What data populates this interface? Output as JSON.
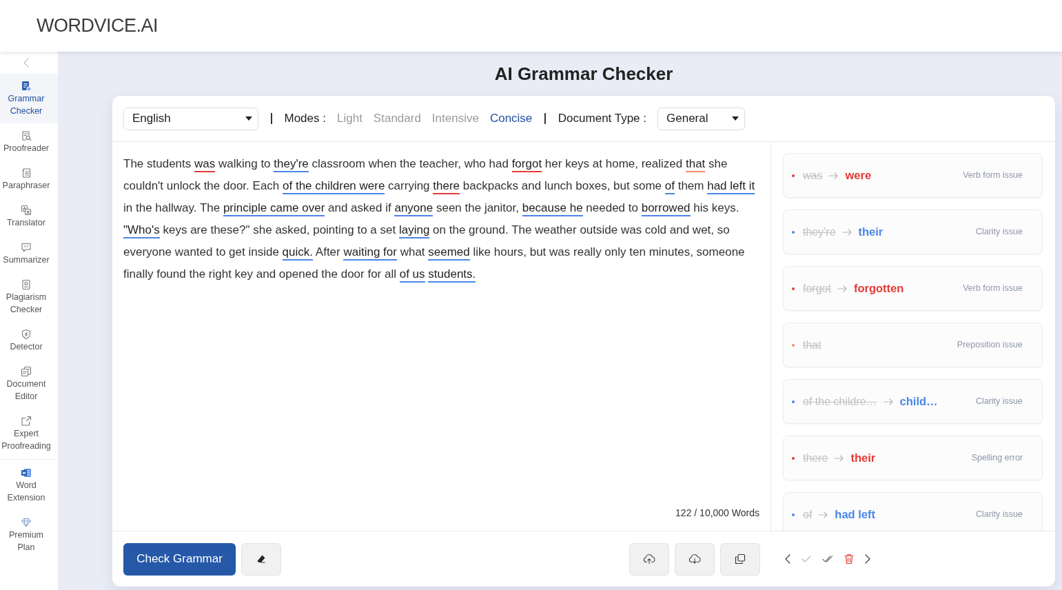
{
  "header": {
    "logo": "WORDVICE.AI"
  },
  "sidebar": {
    "items": [
      {
        "label": "Grammar Checker",
        "selected": true
      },
      {
        "label": "Proofreader",
        "selected": false
      },
      {
        "label": "Paraphraser",
        "selected": false
      },
      {
        "label": "Translator",
        "selected": false
      },
      {
        "label": "Summarizer",
        "selected": false
      },
      {
        "label": "Plagiarism Checker",
        "selected": false
      },
      {
        "label": "Detector",
        "selected": false
      },
      {
        "label": "Document Editor",
        "selected": false
      },
      {
        "label": "Expert Proofreading",
        "selected": false
      }
    ],
    "bottom_items": [
      {
        "label": "Word Extension",
        "selected": false
      },
      {
        "label": "Premium Plan",
        "selected": false
      }
    ]
  },
  "page_title": "AI Grammar Checker",
  "toolbar": {
    "language": "English",
    "modes_label": "Modes :",
    "modes": [
      {
        "label": "Light",
        "selected": false
      },
      {
        "label": "Standard",
        "selected": false
      },
      {
        "label": "Intensive",
        "selected": false
      },
      {
        "label": "Concise",
        "selected": true
      }
    ],
    "document_type_label": "Document Type :",
    "document_type": "General"
  },
  "editor": {
    "segments": [
      {
        "text": "The students "
      },
      {
        "text": "was",
        "color": "#e53935"
      },
      {
        "text": " walking to "
      },
      {
        "text": "they're",
        "color": "#4a86e8"
      },
      {
        "text": " classroom when the teacher, who had "
      },
      {
        "text": "forgot",
        "color": "#e53935"
      },
      {
        "text": " her keys at home, realized "
      },
      {
        "text": "that",
        "color": "#f28b6b"
      },
      {
        "text": " she couldn't unlock the door. Each "
      },
      {
        "text": "of the children were",
        "color": "#4a86e8"
      },
      {
        "text": " carrying "
      },
      {
        "text": "there",
        "color": "#e53935"
      },
      {
        "text": " backpacks and lunch boxes, but some "
      },
      {
        "text": "of",
        "color": "#4a86e8"
      },
      {
        "text": " them "
      },
      {
        "text": "had left it",
        "color": "#4a86e8"
      },
      {
        "text": " in the hallway. The "
      },
      {
        "text": "principle came over",
        "color": "#4a86e8"
      },
      {
        "text": " and asked if "
      },
      {
        "text": "anyone",
        "color": "#4a86e8"
      },
      {
        "text": " seen the janitor, "
      },
      {
        "text": "because he",
        "color": "#4a86e8"
      },
      {
        "text": " needed to "
      },
      {
        "text": "borrowed",
        "color": "#4a86e8"
      },
      {
        "text": " his keys. "
      },
      {
        "text": "\"Who's",
        "color": "#4a86e8"
      },
      {
        "text": " keys are these?\" she asked, pointing to a set "
      },
      {
        "text": "laying",
        "color": "#4a86e8"
      },
      {
        "text": " on the ground. The weather outside was cold and wet, so everyone wanted to get inside "
      },
      {
        "text": "quick.",
        "color": "#4a86e8"
      },
      {
        "text": " After "
      },
      {
        "text": "waiting for",
        "color": "#4a86e8"
      },
      {
        "text": " what "
      },
      {
        "text": "seemed",
        "color": "#4a86e8"
      },
      {
        "text": " like hours, but was really only ten minutes, someone finally found the right key and opened the door for all "
      },
      {
        "text": "of us",
        "color": "#4a86e8"
      },
      {
        "text": " students.",
        "color": "#4a86e8"
      }
    ],
    "word_count": "122 / 10,000 Words"
  },
  "suggestions": [
    {
      "original": "was",
      "suggestion": "were",
      "issue": "Verb form issue",
      "color": "#e53935"
    },
    {
      "original": "they're",
      "suggestion": "their",
      "issue": "Clarity issue",
      "color": "#4a86e8"
    },
    {
      "original": "forgot",
      "suggestion": "forgotten",
      "issue": "Verb form issue",
      "color": "#e53935"
    },
    {
      "original": "that",
      "issue": "Preposition issue",
      "color": "#f28b6b"
    },
    {
      "original": "of the childre…",
      "suggestion": "child…",
      "issue": "Clarity issue",
      "color": "#4a86e8"
    },
    {
      "original": "there",
      "suggestion": "their",
      "issue": "Spelling error",
      "color": "#e53935"
    },
    {
      "original": "of",
      "suggestion": "had left",
      "issue": "Clarity issue",
      "color": "#4a86e8"
    }
  ],
  "actions": {
    "check_button": "Check Grammar"
  }
}
